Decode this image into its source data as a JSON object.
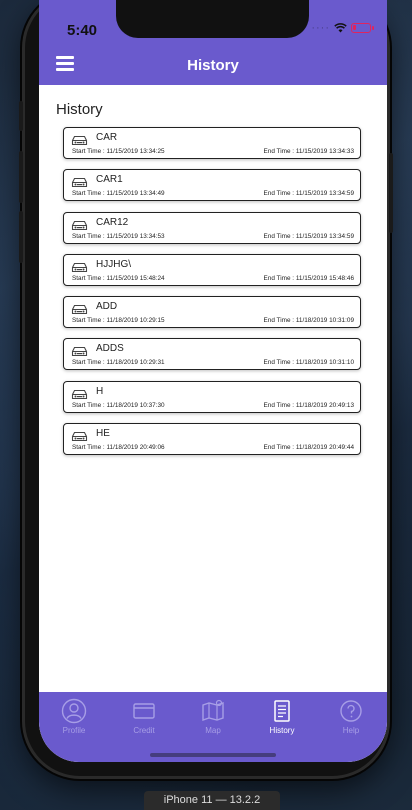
{
  "status_bar": {
    "time": "5:40",
    "signal_icon": "dots-icon",
    "wifi_icon": "wifi-icon",
    "battery_icon": "battery-low-icon"
  },
  "nav_bar": {
    "title": "History",
    "menu_icon": "hamburger-icon"
  },
  "section_title": "History",
  "history": {
    "start_prefix": "Start Time : ",
    "end_prefix": "End Time : ",
    "items": [
      {
        "name": "CAR",
        "start": "Start Time : 11/15/2019 13:34:25",
        "end": "End Time : 11/15/2019 13:34:33"
      },
      {
        "name": "CAR1",
        "start": "Start Time : 11/15/2019 13:34:49",
        "end": "End Time : 11/15/2019 13:34:59"
      },
      {
        "name": "CAR12",
        "start": "Start Time : 11/15/2019 13:34:53",
        "end": "End Time : 11/15/2019 13:34:59"
      },
      {
        "name": "HJJHG\\",
        "start": "Start Time : 11/15/2019 15:48:24",
        "end": "End Time : 11/15/2019 15:48:46"
      },
      {
        "name": "ADD",
        "start": "Start Time : 11/18/2019 10:29:15",
        "end": "End Time : 11/18/2019 10:31:09"
      },
      {
        "name": "ADDS",
        "start": "Start Time : 11/18/2019 10:29:31",
        "end": "End Time : 11/18/2019 10:31:10"
      },
      {
        "name": "H",
        "start": "Start Time : 11/18/2019 10:37:30",
        "end": "End Time : 11/18/2019 20:49:13"
      },
      {
        "name": "HE",
        "start": "Start Time : 11/18/2019 20:49:06",
        "end": "End Time : 11/18/2019 20:49:44"
      }
    ]
  },
  "tabs": [
    {
      "label": "Profile",
      "icon": "profile-icon",
      "active": false
    },
    {
      "label": "Credit",
      "icon": "credit-card-icon",
      "active": false
    },
    {
      "label": "Map",
      "icon": "map-icon",
      "active": false
    },
    {
      "label": "History",
      "icon": "history-icon",
      "active": true
    },
    {
      "label": "Help",
      "icon": "help-icon",
      "active": false
    }
  ],
  "device_label": "iPhone 11 — 13.2.2",
  "colors": {
    "primary": "#6a5acd",
    "tab_inactive": "#a79ee6",
    "battery": "#e0245e"
  }
}
